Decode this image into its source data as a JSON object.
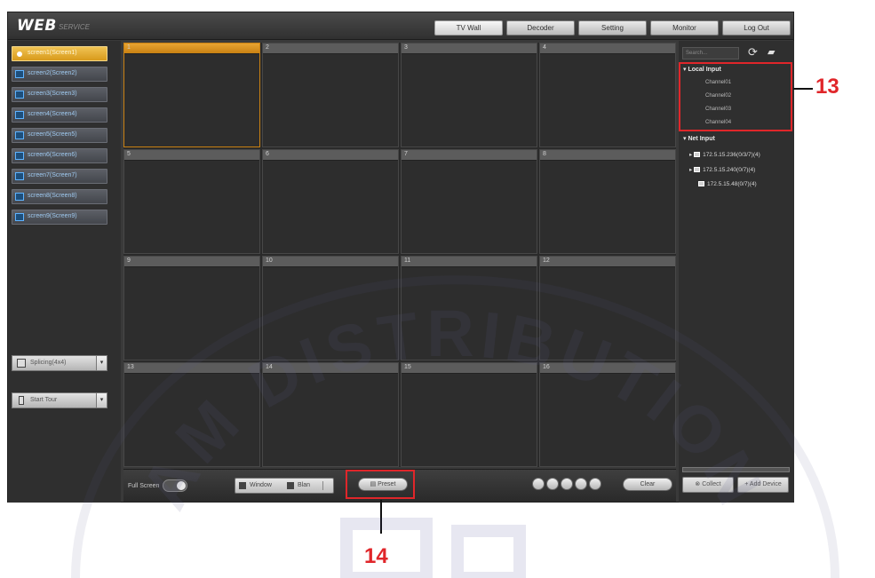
{
  "header": {
    "logo": "WEB",
    "logo_sub": "SERVICE",
    "nav": [
      "TV Wall",
      "Decoder",
      "Setting",
      "Monitor",
      "Log Out"
    ]
  },
  "sidebar": {
    "screens": [
      "screen1(Screen1)",
      "screen2(Screen2)",
      "screen3(Screen3)",
      "screen4(Screen4)",
      "screen5(Screen5)",
      "screen6(Screen6)",
      "screen7(Screen7)",
      "screen8(Screen8)",
      "screen9(Screen9)"
    ],
    "controls": [
      "Splicing(4x4)",
      "Start Tour"
    ]
  },
  "grid": {
    "cells": [
      "1",
      "2",
      "3",
      "4",
      "5",
      "6",
      "7",
      "8",
      "9",
      "10",
      "11",
      "12",
      "13",
      "14",
      "15",
      "16"
    ],
    "selected_index": 0
  },
  "bottom": {
    "fullscreen_label": "Full Screen",
    "group1": [
      "Window",
      "Blan"
    ],
    "preset_label": "Preset",
    "clear_label": "Clear"
  },
  "right_panel": {
    "search_placeholder": "Search...",
    "local_input_label": "Local Input",
    "channels": [
      "Channel01",
      "Channel02",
      "Channel03",
      "Channel04"
    ],
    "net_input_label": "Net Input",
    "ips": [
      "172.5.15.236(0/3/7)(4)",
      "172.5.15.240(0/7)(4)",
      "172.5.15.48(0/7)(4)"
    ],
    "buttons": [
      "Collect",
      "Add Device"
    ]
  },
  "annotations": {
    "label_13": "13",
    "label_14": "14",
    "color": "#e0262a"
  },
  "watermark": {
    "text": "AM DISTRIBUTION"
  }
}
